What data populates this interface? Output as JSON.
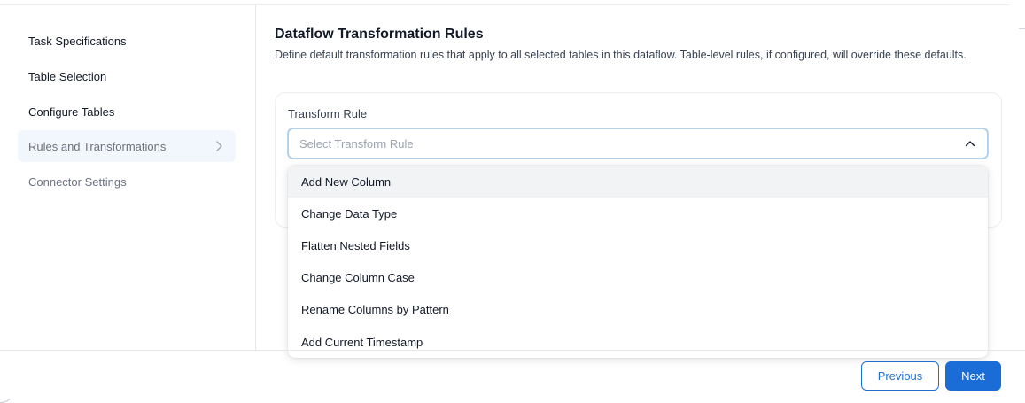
{
  "sidebar": {
    "items": [
      {
        "label": "Task Specifications",
        "state": "normal"
      },
      {
        "label": "Table Selection",
        "state": "normal"
      },
      {
        "label": "Configure Tables",
        "state": "normal"
      },
      {
        "label": "Rules and Transformations",
        "state": "active"
      },
      {
        "label": "Connector Settings",
        "state": "disabled"
      }
    ],
    "active_icon": "chevron-right-icon"
  },
  "main": {
    "title": "Dataflow Transformation Rules",
    "description": "Define default transformation rules that apply to all selected tables in this dataflow. Table-level rules, if configured, will override these defaults.",
    "transform_rule": {
      "label": "Transform Rule",
      "placeholder": "Select Transform Rule",
      "expanded": true,
      "toggle_icon": "chevron-up-icon",
      "options": [
        "Add New Column",
        "Change Data Type",
        "Flatten Nested Fields",
        "Change Column Case",
        "Rename Columns by Pattern",
        "Add Current Timestamp"
      ],
      "highlighted_option": "Add New Column"
    }
  },
  "footer": {
    "previous_label": "Previous",
    "next_label": "Next"
  },
  "colors": {
    "primary": "#1a6cd6",
    "active_nav_bg": "#f1f7fc",
    "focus_border": "#b3d3ec",
    "option_highlight": "#f2f3f5"
  }
}
